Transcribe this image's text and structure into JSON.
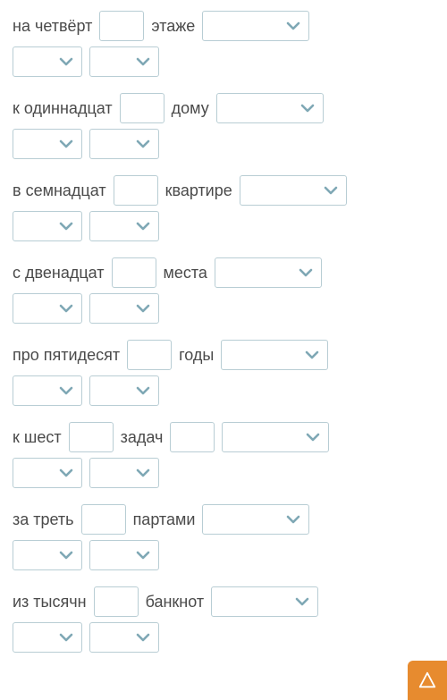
{
  "exercises": [
    {
      "parts": [
        "на четвёрт",
        "этаже"
      ]
    },
    {
      "parts": [
        "к одиннадцат",
        "дому"
      ]
    },
    {
      "parts": [
        "в семнадцат",
        "квартире"
      ]
    },
    {
      "parts": [
        "с двенадцат",
        "места"
      ]
    },
    {
      "parts": [
        "про пятидесят",
        "годы"
      ]
    },
    {
      "parts": [
        "к шест",
        "задач"
      ]
    },
    {
      "parts": [
        "за треть",
        "партами"
      ]
    },
    {
      "parts": [
        "из тысячн",
        "банкнот"
      ]
    }
  ]
}
